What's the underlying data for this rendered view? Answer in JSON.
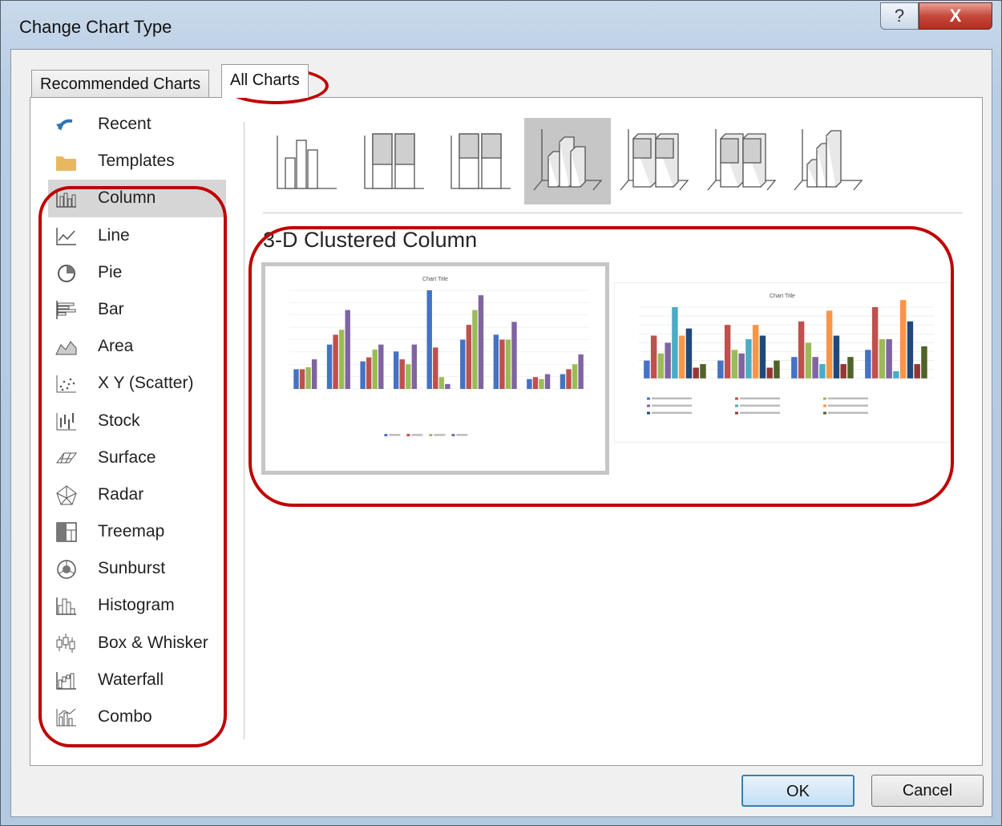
{
  "window": {
    "title": "Change Chart Type",
    "help_glyph": "?",
    "close_glyph": "X"
  },
  "tabs": [
    {
      "label": "Recommended Charts"
    },
    {
      "label": "All Charts"
    }
  ],
  "sidebar": {
    "items": [
      {
        "label": "Recent",
        "icon": "recent-icon"
      },
      {
        "label": "Templates",
        "icon": "folder-icon"
      },
      {
        "label": "Column",
        "icon": "column-chart-icon",
        "selected": true
      },
      {
        "label": "Line",
        "icon": "line-chart-icon"
      },
      {
        "label": "Pie",
        "icon": "pie-chart-icon"
      },
      {
        "label": "Bar",
        "icon": "bar-chart-icon"
      },
      {
        "label": "Area",
        "icon": "area-chart-icon"
      },
      {
        "label": "X Y (Scatter)",
        "icon": "scatter-chart-icon"
      },
      {
        "label": "Stock",
        "icon": "stock-chart-icon"
      },
      {
        "label": "Surface",
        "icon": "surface-chart-icon"
      },
      {
        "label": "Radar",
        "icon": "radar-chart-icon"
      },
      {
        "label": "Treemap",
        "icon": "treemap-chart-icon"
      },
      {
        "label": "Sunburst",
        "icon": "sunburst-chart-icon"
      },
      {
        "label": "Histogram",
        "icon": "histogram-chart-icon"
      },
      {
        "label": "Box & Whisker",
        "icon": "box-whisker-chart-icon"
      },
      {
        "label": "Waterfall",
        "icon": "waterfall-chart-icon"
      },
      {
        "label": "Combo",
        "icon": "combo-chart-icon"
      }
    ]
  },
  "subtypes": {
    "count": 7,
    "selected_index": 3
  },
  "variant_title": "3-D Clustered Column",
  "previews": [
    {
      "chart_title": "Chart Title",
      "selected": true
    },
    {
      "chart_title": "Chart Title",
      "selected": false
    }
  ],
  "buttons": {
    "ok": "OK",
    "cancel": "Cancel"
  },
  "colors": {
    "selection_gray": "#c6c6c6",
    "annotation_red": "#c00000",
    "series": [
      "#4472c4",
      "#c0504d",
      "#9bbb59",
      "#8064a2",
      "#4bacc6",
      "#f79646",
      "#1f497d",
      "#943634",
      "#4f6228"
    ]
  }
}
